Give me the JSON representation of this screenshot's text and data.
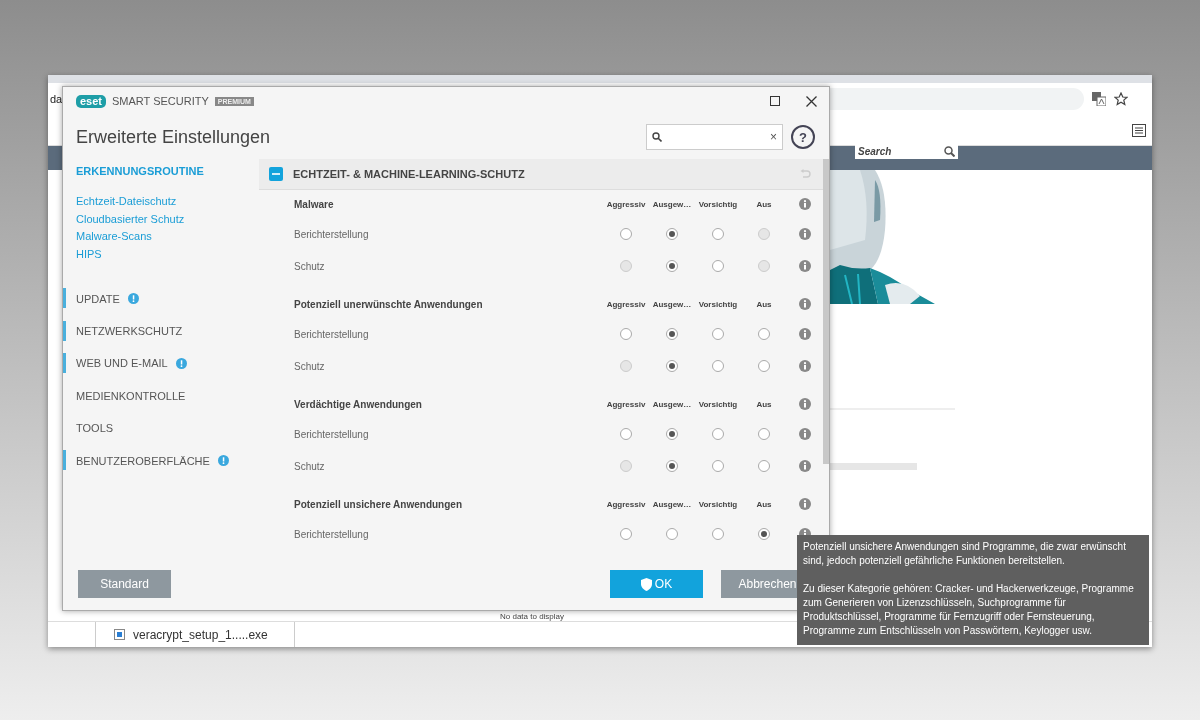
{
  "browser": {
    "tab_text": "da",
    "search_placeholder": "Search",
    "download_file": "veracrypt_setup_1.....exe",
    "status_text": "No data to display"
  },
  "dialog": {
    "brand": "eset",
    "product": "SMART SECURITY",
    "edition": "PREMIUM",
    "title": "Erweiterte Einstellungen",
    "search_clear": "×",
    "help": "?"
  },
  "sidebar": {
    "heading": "ERKENNUNGSROUTINE",
    "links": [
      "Echtzeit-Dateischutz",
      "Cloudbasierter Schutz",
      "Malware-Scans",
      "HIPS"
    ],
    "sections": [
      {
        "label": "UPDATE",
        "marked": true,
        "alert": true
      },
      {
        "label": "NETZWERKSCHUTZ",
        "marked": true,
        "alert": false
      },
      {
        "label": "WEB UND E-MAIL",
        "marked": true,
        "alert": true
      },
      {
        "label": "MEDIENKONTROLLE",
        "marked": false,
        "alert": false
      },
      {
        "label": "TOOLS",
        "marked": false,
        "alert": false
      },
      {
        "label": "BENUTZEROBERFLÄCHE",
        "marked": true,
        "alert": true
      }
    ]
  },
  "section": {
    "title": "ECHTZEIT- & MACHINE-LEARNING-SCHUTZ",
    "expanded": true,
    "groups": [
      {
        "title": "Malware",
        "columns": [
          "Aggressiv",
          "Ausgew…",
          "Vorsichtig",
          "Aus"
        ],
        "rows": [
          {
            "label": "Berichterstellung",
            "options": [
              {
                "selected": false,
                "disabled": false
              },
              {
                "selected": true,
                "disabled": false
              },
              {
                "selected": false,
                "disabled": false
              },
              {
                "selected": false,
                "disabled": true
              }
            ]
          },
          {
            "label": "Schutz",
            "options": [
              {
                "selected": false,
                "disabled": true
              },
              {
                "selected": true,
                "disabled": false
              },
              {
                "selected": false,
                "disabled": false
              },
              {
                "selected": false,
                "disabled": true
              }
            ]
          }
        ]
      },
      {
        "title": "Potenziell unerwünschte Anwendungen",
        "columns": [
          "Aggressiv",
          "Ausgew…",
          "Vorsichtig",
          "Aus"
        ],
        "rows": [
          {
            "label": "Berichterstellung",
            "options": [
              {
                "selected": false,
                "disabled": false
              },
              {
                "selected": true,
                "disabled": false
              },
              {
                "selected": false,
                "disabled": false
              },
              {
                "selected": false,
                "disabled": false
              }
            ]
          },
          {
            "label": "Schutz",
            "options": [
              {
                "selected": false,
                "disabled": true
              },
              {
                "selected": true,
                "disabled": false
              },
              {
                "selected": false,
                "disabled": false
              },
              {
                "selected": false,
                "disabled": false
              }
            ]
          }
        ]
      },
      {
        "title": "Verdächtige Anwendungen",
        "columns": [
          "Aggressiv",
          "Ausgew…",
          "Vorsichtig",
          "Aus"
        ],
        "rows": [
          {
            "label": "Berichterstellung",
            "options": [
              {
                "selected": false,
                "disabled": false
              },
              {
                "selected": true,
                "disabled": false
              },
              {
                "selected": false,
                "disabled": false
              },
              {
                "selected": false,
                "disabled": false
              }
            ]
          },
          {
            "label": "Schutz",
            "options": [
              {
                "selected": false,
                "disabled": true
              },
              {
                "selected": true,
                "disabled": false
              },
              {
                "selected": false,
                "disabled": false
              },
              {
                "selected": false,
                "disabled": false
              }
            ]
          }
        ]
      },
      {
        "title": "Potenziell unsichere Anwendungen",
        "columns": [
          "Aggressiv",
          "Ausgew…",
          "Vorsichtig",
          "Aus"
        ],
        "rows": [
          {
            "label": "Berichterstellung",
            "options": [
              {
                "selected": false,
                "disabled": false
              },
              {
                "selected": false,
                "disabled": false
              },
              {
                "selected": false,
                "disabled": false
              },
              {
                "selected": true,
                "disabled": false
              }
            ]
          }
        ]
      }
    ]
  },
  "buttons": [
    {
      "label": "Standard",
      "kind": "default"
    },
    {
      "label": "OK",
      "kind": "primary"
    },
    {
      "label": "Abbrechen",
      "kind": "secondary"
    }
  ],
  "tooltip": {
    "paragraphs": [
      "Potenziell unsichere Anwendungen sind Programme, die zwar erwünscht sind, jedoch potenziell gefährliche Funktionen bereitstellen.",
      "Zu dieser Kategorie gehören: Cracker- und Hackerwerkzeuge, Programme zum Generieren von Lizenzschlüsseln, Suchprogramme für Produktschlüssel, Programme für Fernzugriff oder Fernsteuerung, Programme zum Entschlüsseln von Passwörtern, Keylogger usw."
    ]
  }
}
